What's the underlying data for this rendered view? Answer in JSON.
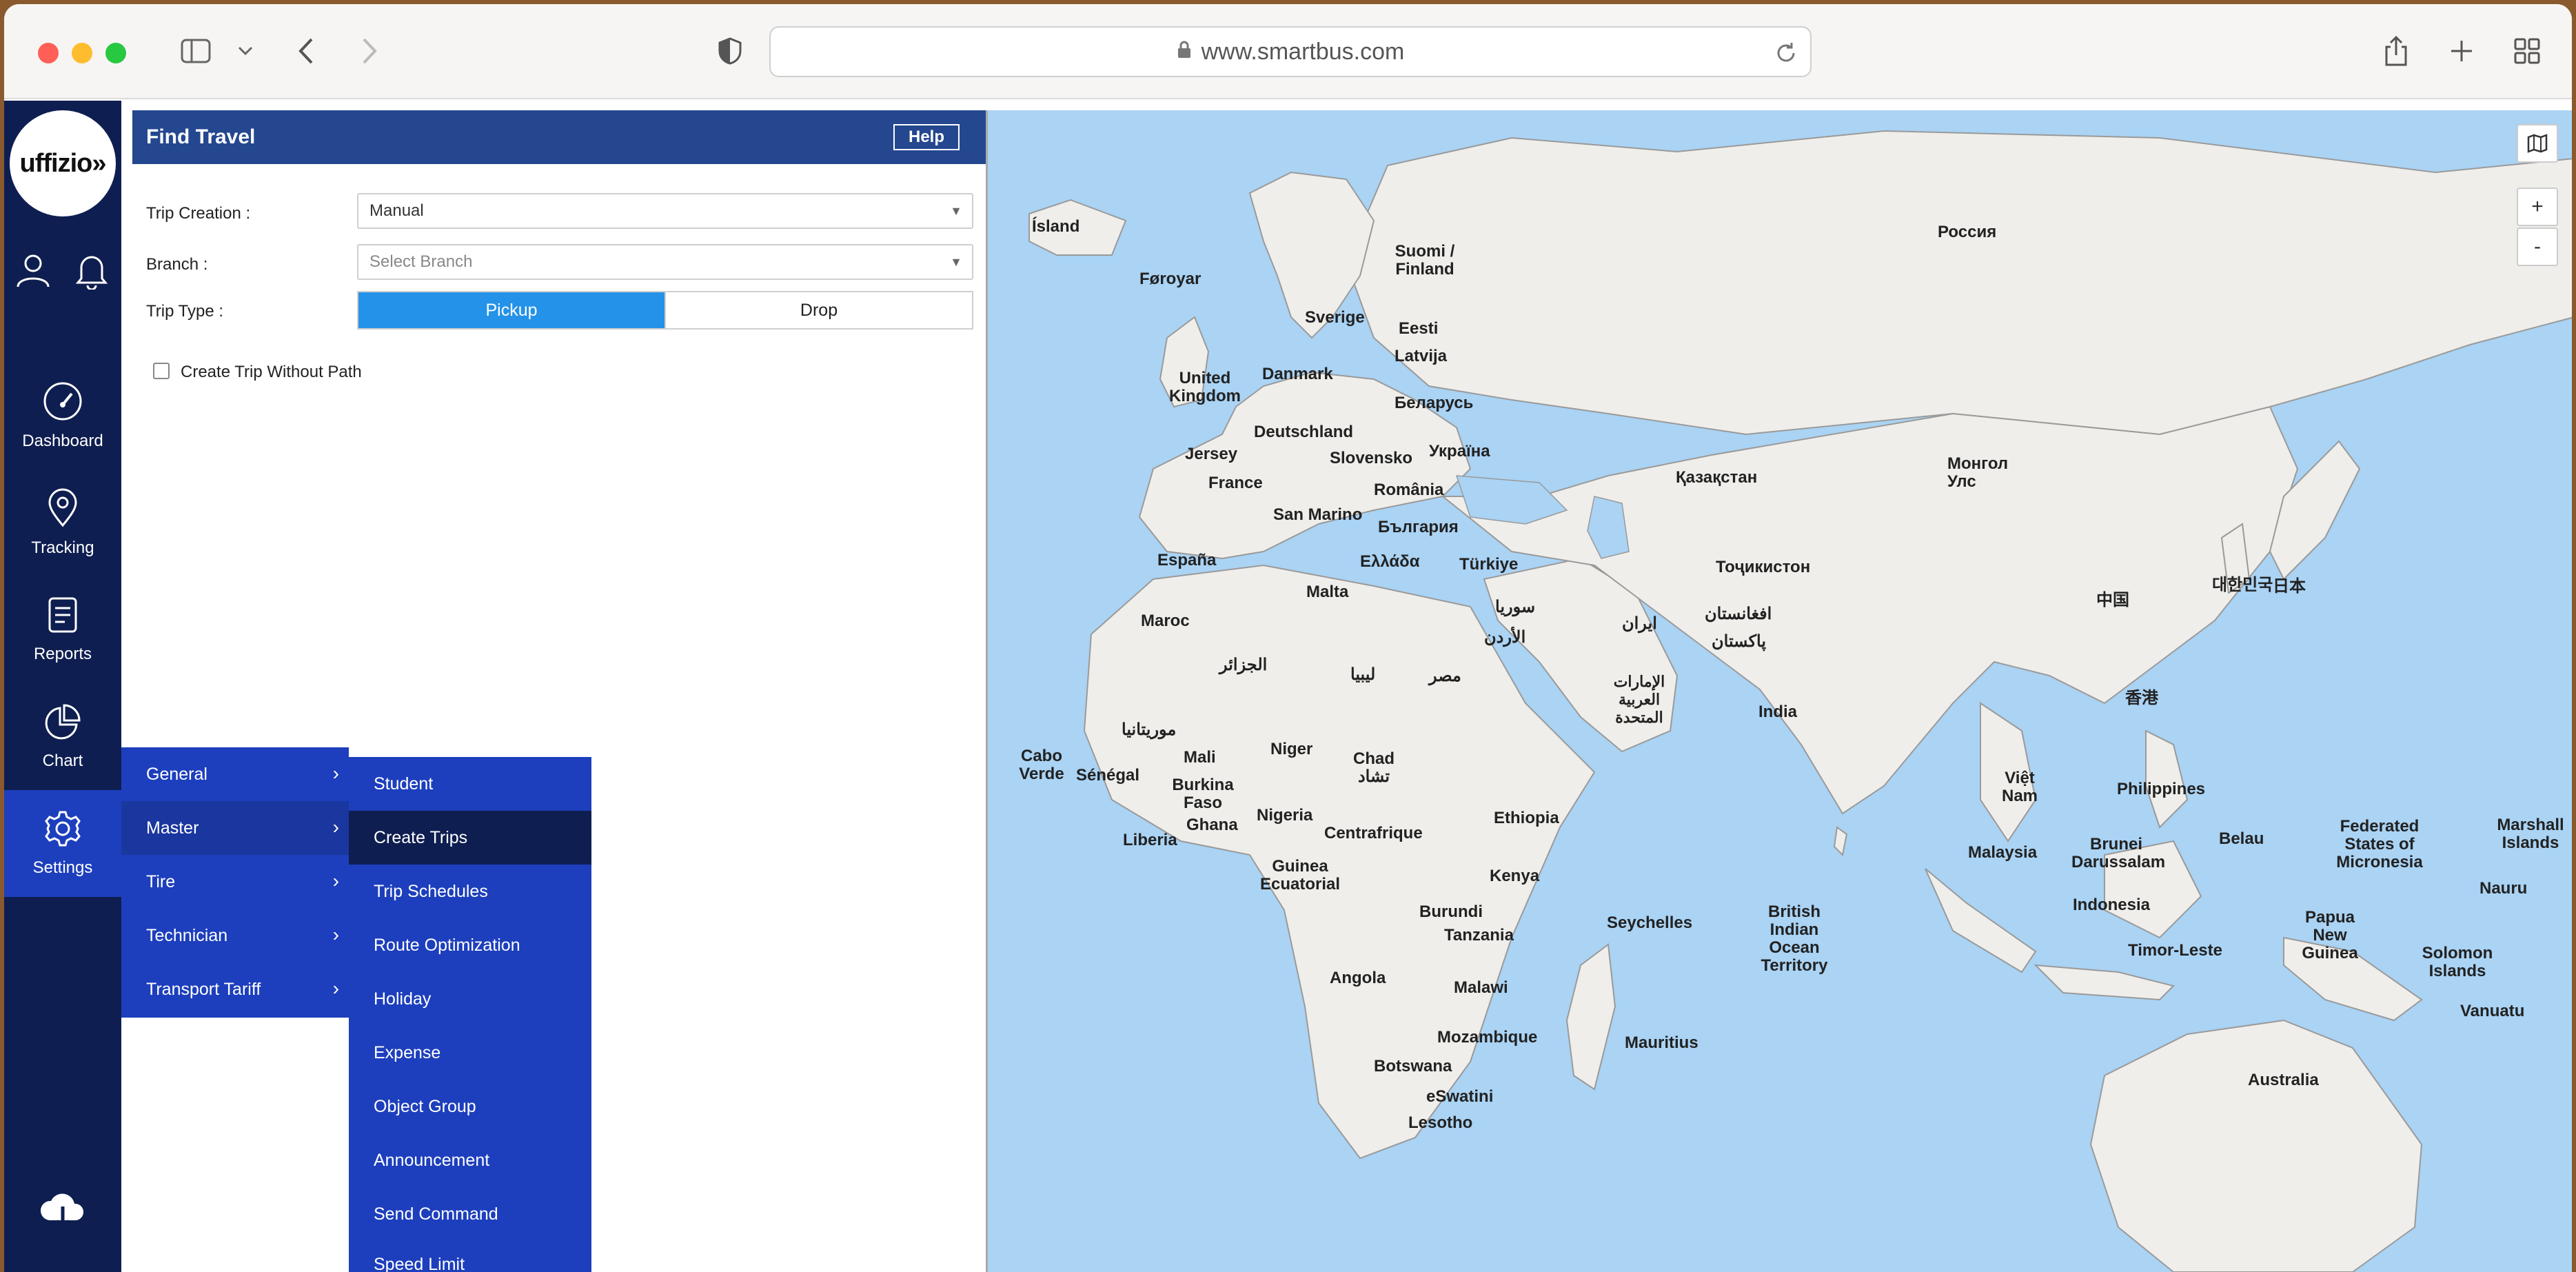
{
  "browser": {
    "url": "www.smartbus.com",
    "lights": {
      "close": "#ff5f57",
      "minimize": "#febc2e",
      "zoom": "#28c840"
    }
  },
  "app": {
    "logo_text": "uffizio",
    "nav": [
      {
        "label": "Dashboard",
        "icon": "speedometer-icon"
      },
      {
        "label": "Tracking",
        "icon": "location-pin-icon"
      },
      {
        "label": "Reports",
        "icon": "report-icon"
      },
      {
        "label": "Chart",
        "icon": "pie-chart-icon"
      },
      {
        "label": "Settings",
        "icon": "gear-icon"
      }
    ]
  },
  "panel": {
    "title": "Find Travel",
    "help_label": "Help",
    "trip_creation_label": "Trip Creation :",
    "trip_creation_value": "Manual",
    "branch_label": "Branch :",
    "branch_placeholder": "Select Branch",
    "trip_type_label": "Trip Type :",
    "pickup_label": "Pickup",
    "drop_label": "Drop",
    "checkbox_label": "Create Trip Without Path"
  },
  "menu1": [
    {
      "label": "General"
    },
    {
      "label": "Master"
    },
    {
      "label": "Tire"
    },
    {
      "label": "Technician"
    },
    {
      "label": "Transport Tariff"
    }
  ],
  "menu2": [
    {
      "label": "Student"
    },
    {
      "label": "Create Trips"
    },
    {
      "label": "Trip Schedules"
    },
    {
      "label": "Route Optimization"
    },
    {
      "label": "Holiday"
    },
    {
      "label": "Expense"
    },
    {
      "label": "Object Group"
    },
    {
      "label": "Announcement"
    },
    {
      "label": "Send Command"
    },
    {
      "label": "Speed Limit"
    }
  ],
  "map": {
    "zoom_in": "+",
    "zoom_out": "-",
    "labels": [
      {
        "text": "Россия"
      },
      {
        "text": "Ísland"
      },
      {
        "text": "Føroyar"
      },
      {
        "text": "Suomi / Finland"
      },
      {
        "text": "Sverige"
      },
      {
        "text": "Eesti"
      },
      {
        "text": "Latvija"
      },
      {
        "text": "Danmark"
      },
      {
        "text": "United Kingdom"
      },
      {
        "text": "Беларусь"
      },
      {
        "text": "Deutschland"
      },
      {
        "text": "Україна"
      },
      {
        "text": "Jersey"
      },
      {
        "text": "Slovensko"
      },
      {
        "text": "France"
      },
      {
        "text": "România"
      },
      {
        "text": "San Marino"
      },
      {
        "text": "България"
      },
      {
        "text": "Қазақстан"
      },
      {
        "text": "Монгол Улс"
      },
      {
        "text": "España"
      },
      {
        "text": "Ελλάδα"
      },
      {
        "text": "Türkiye"
      },
      {
        "text": "Тоҷикистон"
      },
      {
        "text": "Malta"
      },
      {
        "text": "سوريا"
      },
      {
        "text": "Maroc"
      },
      {
        "text": "الأردن"
      },
      {
        "text": "افغانستان"
      },
      {
        "text": "ایران"
      },
      {
        "text": "پاکستان"
      },
      {
        "text": "中国"
      },
      {
        "text": "대한민국"
      },
      {
        "text": "日本"
      },
      {
        "text": "الجزائر"
      },
      {
        "text": "ليبيا"
      },
      {
        "text": "مصر"
      },
      {
        "text": "الإمارات العربية المتحدة"
      },
      {
        "text": "India"
      },
      {
        "text": "香港"
      },
      {
        "text": "موريتانيا"
      },
      {
        "text": "Cabo Verde"
      },
      {
        "text": "Mali"
      },
      {
        "text": "Niger"
      },
      {
        "text": "Chad تشاد"
      },
      {
        "text": "Sénégal"
      },
      {
        "text": "Burkina Faso"
      },
      {
        "text": "Ghana"
      },
      {
        "text": "Nigeria"
      },
      {
        "text": "Ethiopia"
      },
      {
        "text": "Việt Nam"
      },
      {
        "text": "Philippines"
      },
      {
        "text": "Liberia"
      },
      {
        "text": "Centrafrique"
      },
      {
        "text": "Malaysia"
      },
      {
        "text": "Brunei Darussalam"
      },
      {
        "text": "Belau"
      },
      {
        "text": "Federated States of Micronesia"
      },
      {
        "text": "Marshall Islands"
      },
      {
        "text": "Guinea Ecuatorial"
      },
      {
        "text": "Kenya"
      },
      {
        "text": "Nauru"
      },
      {
        "text": "Indonesia"
      },
      {
        "text": "Burundi"
      },
      {
        "text": "Seychelles"
      },
      {
        "text": "British Indian Ocean Territory"
      },
      {
        "text": "Tanzania"
      },
      {
        "text": "Papua New Guinea"
      },
      {
        "text": "Timor-Leste"
      },
      {
        "text": "Solomon Islands"
      },
      {
        "text": "Angola"
      },
      {
        "text": "Malawi"
      },
      {
        "text": "Vanuatu"
      },
      {
        "text": "Mauritius"
      },
      {
        "text": "Mozambique"
      },
      {
        "text": "Botswana"
      },
      {
        "text": "Australia"
      },
      {
        "text": "eSwatini"
      },
      {
        "text": "Lesotho"
      }
    ]
  }
}
